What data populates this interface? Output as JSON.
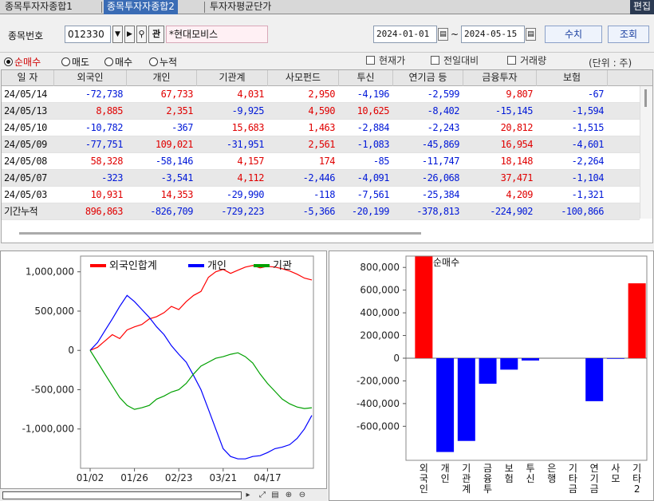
{
  "tabs": [
    {
      "label": "종목투자자종합1",
      "active": false
    },
    {
      "label": "종목투자자종합2",
      "active": true
    },
    {
      "label": "투자자평균단가",
      "active": false
    }
  ],
  "edit_label": "편집",
  "controls": {
    "code_label": "종목번호",
    "code_value": "012330",
    "search_glyph": "⚲",
    "chart_btn": "관",
    "stock_name": "*현대모비스",
    "date_from": "2024-01-01",
    "date_sep": "~",
    "date_to": "2024-05-15",
    "numbers_btn": "수치",
    "query_btn": "조회"
  },
  "options": {
    "radios": [
      {
        "label": "순매수",
        "selected": true
      },
      {
        "label": "매도",
        "selected": false
      },
      {
        "label": "매수",
        "selected": false
      },
      {
        "label": "누적",
        "selected": false
      }
    ],
    "checks": [
      "현재가",
      "전일대비",
      "거래량"
    ],
    "unit": "(단위 : 주)"
  },
  "table": {
    "headers": [
      "일 자",
      "외국인",
      "개인",
      "기관계",
      "사모펀드",
      "투신",
      "연기금 등",
      "금융투자",
      "보험"
    ],
    "rows": [
      [
        "24/05/14",
        "-72,738",
        "67,733",
        "4,031",
        "2,950",
        "-4,196",
        "-2,599",
        "9,807",
        "-67"
      ],
      [
        "24/05/13",
        "8,885",
        "2,351",
        "-9,925",
        "4,590",
        "10,625",
        "-8,402",
        "-15,145",
        "-1,594"
      ],
      [
        "24/05/10",
        "-10,782",
        "-367",
        "15,683",
        "1,463",
        "-2,884",
        "-2,243",
        "20,812",
        "-1,515"
      ],
      [
        "24/05/09",
        "-77,751",
        "109,021",
        "-31,951",
        "2,561",
        "-1,083",
        "-45,869",
        "16,954",
        "-4,601"
      ],
      [
        "24/05/08",
        "58,328",
        "-58,146",
        "4,157",
        "174",
        "-85",
        "-11,747",
        "18,148",
        "-2,264"
      ],
      [
        "24/05/07",
        "-323",
        "-3,541",
        "4,112",
        "-2,446",
        "-4,091",
        "-26,068",
        "37,471",
        "-1,104"
      ],
      [
        "24/05/03",
        "10,931",
        "14,353",
        "-29,990",
        "-118",
        "-7,561",
        "-25,384",
        "4,209",
        "-1,321"
      ]
    ],
    "total_row": [
      "기간누적",
      "896,863",
      "-826,709",
      "-729,223",
      "-5,366",
      "-20,199",
      "-378,813",
      "-224,902",
      "-100,866"
    ]
  },
  "chart_data": [
    {
      "type": "line",
      "title": "",
      "series": [
        {
          "name": "외국인합계",
          "color": "#ff0000"
        },
        {
          "name": "개인",
          "color": "#0000ff"
        },
        {
          "name": "기관",
          "color": "#00a000"
        }
      ],
      "x_ticks": [
        "01/02",
        "01/26",
        "02/23",
        "03/21",
        "04/17"
      ],
      "y_ticks": [
        "1,000,000",
        "500,000",
        "0",
        "-500,000",
        "-1,000,000"
      ],
      "ylim": [
        -1500000,
        1200000
      ],
      "x": [
        "01/02",
        "01/05",
        "01/09",
        "01/12",
        "01/17",
        "01/22",
        "01/26",
        "01/31",
        "02/05",
        "02/08",
        "02/14",
        "02/19",
        "02/23",
        "02/28",
        "03/05",
        "03/08",
        "03/13",
        "03/18",
        "03/21",
        "03/26",
        "03/29",
        "04/03",
        "04/08",
        "04/11",
        "04/17",
        "04/22",
        "04/25",
        "04/30",
        "05/03",
        "05/09",
        "05/14"
      ],
      "values_foreign": [
        0,
        40000,
        120000,
        200000,
        150000,
        260000,
        300000,
        330000,
        400000,
        430000,
        480000,
        560000,
        520000,
        620000,
        700000,
        750000,
        930000,
        1000000,
        1030000,
        980000,
        1020000,
        1060000,
        1080000,
        1050000,
        1070000,
        1060000,
        1040000,
        1010000,
        970000,
        920000,
        896863
      ],
      "values_individual": [
        0,
        100000,
        250000,
        400000,
        560000,
        700000,
        620000,
        520000,
        420000,
        300000,
        200000,
        60000,
        -50000,
        -150000,
        -320000,
        -500000,
        -750000,
        -1000000,
        -1250000,
        -1350000,
        -1380000,
        -1380000,
        -1350000,
        -1340000,
        -1300000,
        -1250000,
        -1230000,
        -1200000,
        -1120000,
        -1000000,
        -826709
      ],
      "values_institution": [
        0,
        -150000,
        -300000,
        -450000,
        -600000,
        -700000,
        -750000,
        -730000,
        -700000,
        -620000,
        -580000,
        -530000,
        -500000,
        -420000,
        -300000,
        -200000,
        -150000,
        -100000,
        -80000,
        -50000,
        -30000,
        -80000,
        -160000,
        -300000,
        -420000,
        -520000,
        -620000,
        -680000,
        -720000,
        -740000,
        -729223
      ]
    },
    {
      "type": "bar",
      "title": "순매수",
      "categories": [
        "외국인",
        "개인",
        "기관계",
        "금융투",
        "보험",
        "투신",
        "은행",
        "기타금",
        "연기금",
        "사모",
        "기타2"
      ],
      "values": [
        896863,
        -826709,
        -729223,
        -224902,
        -100866,
        -20199,
        0,
        0,
        -378813,
        -5366,
        660000
      ],
      "y_ticks": [
        "800,000",
        "600,000",
        "400,000",
        "200,000",
        "0",
        "-200,000",
        "-400,000",
        "-600,000"
      ],
      "ylim": [
        -900000,
        900000
      ],
      "positive_color": "#ff0000",
      "negative_color": "#0000ff"
    }
  ]
}
